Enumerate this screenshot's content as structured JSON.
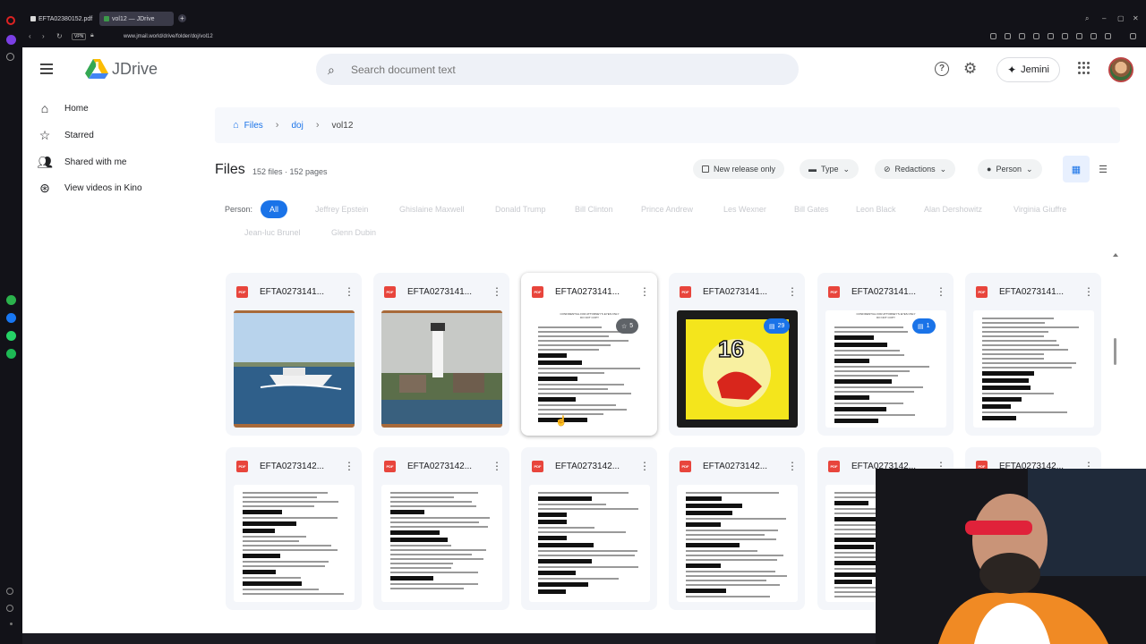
{
  "browser": {
    "tabs": [
      {
        "title": "EFTA02380152.pdf",
        "active": false
      },
      {
        "title": "vol12 — JDrive",
        "active": true
      }
    ],
    "url": "www.jmail.world/drive/folder/doj/vol12",
    "vpn_label": "VPN"
  },
  "app": {
    "logo_text": "JDrive",
    "search_placeholder": "Search document text",
    "jemini_label": "Jemini"
  },
  "sidebar": {
    "items": [
      {
        "label": "Home",
        "icon": "home-icon"
      },
      {
        "label": "Starred",
        "icon": "star-icon"
      },
      {
        "label": "Shared with me",
        "icon": "people-icon"
      },
      {
        "label": "View videos in Kino",
        "icon": "film-reel-icon"
      }
    ]
  },
  "breadcrumb": {
    "items": [
      "Files",
      "doj",
      "vol12"
    ]
  },
  "files": {
    "title": "Files",
    "count": "152 files · 152 pages"
  },
  "filters": {
    "new_release": "New release only",
    "type": "Type",
    "redactions": "Redactions",
    "person": "Person"
  },
  "person_filter": {
    "label": "Person:",
    "options": [
      "All",
      "Jeffrey Epstein",
      "Ghislaine Maxwell",
      "Donald Trump",
      "Bill Clinton",
      "Prince Andrew",
      "Les Wexner",
      "Bill Gates",
      "Leon Black",
      "Alan Dershowitz",
      "Virginia Giuffre",
      "Jean-luc Brunel",
      "Glenn Dubin"
    ],
    "selected": "All"
  },
  "grid": {
    "row1": [
      {
        "name": "EFTA0273141...",
        "thumb": "photo-boat"
      },
      {
        "name": "EFTA0273141...",
        "thumb": "photo-lighthouse"
      },
      {
        "name": "EFTA0273141...",
        "thumb": "doc",
        "badge": "5",
        "badge_icon": "star"
      },
      {
        "name": "EFTA0273141...",
        "thumb": "photo-notebook",
        "badge": "29",
        "badge_icon": "comment"
      },
      {
        "name": "EFTA0273141...",
        "thumb": "doc",
        "badge": "1",
        "badge_icon": "comment"
      },
      {
        "name": "EFTA0273141...",
        "thumb": "doc"
      }
    ],
    "row2": [
      {
        "name": "EFTA0273142...",
        "thumb": "doc"
      },
      {
        "name": "EFTA0273142...",
        "thumb": "doc"
      },
      {
        "name": "EFTA0273142...",
        "thumb": "doc"
      },
      {
        "name": "EFTA0273142...",
        "thumb": "doc"
      },
      {
        "name": "EFTA0273142...",
        "thumb": "doc"
      },
      {
        "name": "EFTA0273142...",
        "thumb": "doc"
      }
    ]
  },
  "doc_thumb_text": {
    "confidential_line1": "CONFIDENTIAL FOR ATTORNEY'S EYES ONLY",
    "confidential_line2": "DO NOT COPY"
  },
  "notebook_number": "16"
}
